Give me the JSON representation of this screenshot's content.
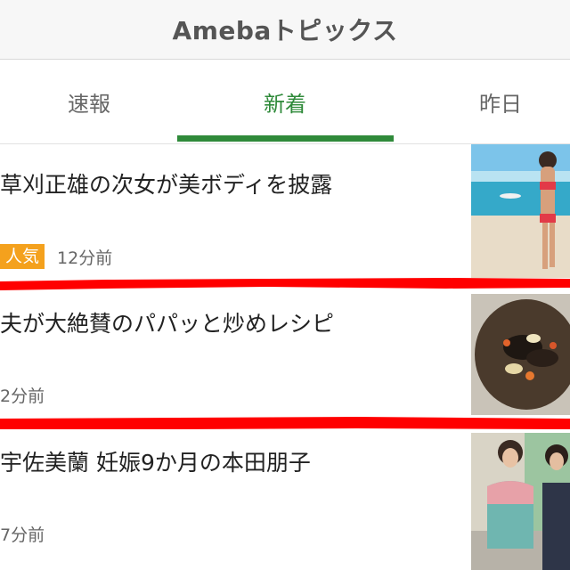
{
  "header": {
    "title": "Amebaトピックス"
  },
  "tabs": [
    {
      "label": "速報",
      "active": false
    },
    {
      "label": "新着",
      "active": true
    },
    {
      "label": "昨日",
      "active": false
    }
  ],
  "accent_color": "#2f8a3a",
  "badge_color": "#f4a11d",
  "annotation_color": "#ff0000",
  "articles": [
    {
      "title": "草刈正雄の次女が美ボディを披露",
      "badge": "人気",
      "time": "12分前",
      "thumbnail": "beach-photo"
    },
    {
      "title": "夫が大絶賛のパパッと炒めレシピ",
      "badge": "",
      "time": "2分前",
      "thumbnail": "food-dish-photo"
    },
    {
      "title": "宇佐美蘭 妊娠9か月の本田朋子",
      "badge": "",
      "time": "7分前",
      "thumbnail": "two-women-photo"
    }
  ]
}
